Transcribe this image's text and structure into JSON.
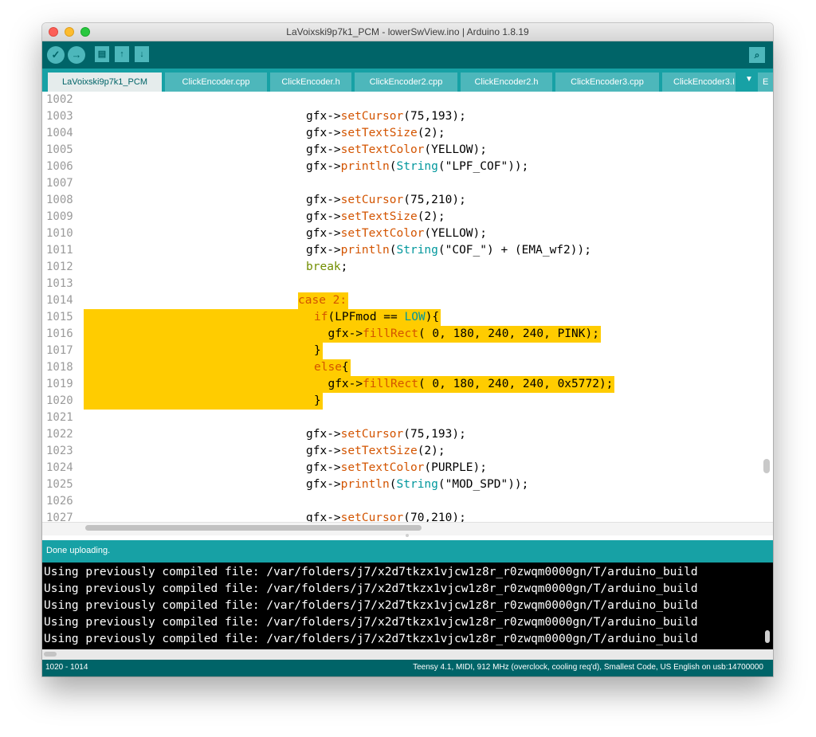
{
  "window": {
    "title": "LaVoixski9p7k1_PCM - lowerSwView.ino | Arduino 1.8.19"
  },
  "toolbar": {
    "verify_icon": "✓",
    "upload_icon": "→",
    "new_icon": "▤",
    "open_icon": "↑",
    "save_icon": "↓",
    "serial_monitor_icon": "⌕"
  },
  "tabs": [
    {
      "label": "LaVoixski9p7k1_PCM",
      "active": true
    },
    {
      "label": "ClickEncoder.cpp"
    },
    {
      "label": "ClickEncoder.h"
    },
    {
      "label": "ClickEncoder2.cpp"
    },
    {
      "label": "ClickEncoder2.h"
    },
    {
      "label": "ClickEncoder3.cpp"
    },
    {
      "label": "ClickEncoder3.I"
    },
    {
      "label": "E"
    }
  ],
  "tab_menu_icon": "▼",
  "line_numbers": [
    "1002",
    "1003",
    "1004",
    "1005",
    "1006",
    "1007",
    "1008",
    "1009",
    "1010",
    "1011",
    "1012",
    "1013",
    "1014",
    "1015",
    "1016",
    "1017",
    "1018",
    "1019",
    "1020",
    "1021",
    "1022",
    "1023",
    "1024",
    "1025",
    "1026",
    "1027"
  ],
  "code": {
    "l1003": {
      "a": "gfx->",
      "b": "setCursor",
      "c": "(75,193);"
    },
    "l1004": {
      "a": "gfx->",
      "b": "setTextSize",
      "c": "(2);"
    },
    "l1005": {
      "a": "gfx->",
      "b": "setTextColor",
      "c": "(YELLOW);"
    },
    "l1006": {
      "a": "gfx->",
      "b": "println",
      "c": "(",
      "d": "String",
      "e": "(\"LPF_COF\"));"
    },
    "l1008": {
      "a": "gfx->",
      "b": "setCursor",
      "c": "(75,210);"
    },
    "l1009": {
      "a": "gfx->",
      "b": "setTextSize",
      "c": "(2);"
    },
    "l1010": {
      "a": "gfx->",
      "b": "setTextColor",
      "c": "(YELLOW);"
    },
    "l1011": {
      "a": "gfx->",
      "b": "println",
      "c": "(",
      "d": "String",
      "e": "(\"COF_\") + (EMA_wf2));"
    },
    "l1012": {
      "a": "break",
      "b": ";"
    },
    "l1014": {
      "a": "case",
      "b": " 2:"
    },
    "l1015": {
      "a": "if",
      "b": "(LPFmod == ",
      "c": "LOW",
      "d": "){"
    },
    "l1016": {
      "a": "gfx->",
      "b": "fillRect",
      "c": "( 0, 180, 240, 240, PINK);"
    },
    "l1017": {
      "a": "}"
    },
    "l1018": {
      "a": "else",
      "b": "{"
    },
    "l1019": {
      "a": "gfx->",
      "b": "fillRect",
      "c": "( 0, 180, 240, 240, 0x5772);"
    },
    "l1020": {
      "a": "}"
    },
    "l1022": {
      "a": "gfx->",
      "b": "setCursor",
      "c": "(75,193);"
    },
    "l1023": {
      "a": "gfx->",
      "b": "setTextSize",
      "c": "(2);"
    },
    "l1024": {
      "a": "gfx->",
      "b": "setTextColor",
      "c": "(PURPLE);"
    },
    "l1025": {
      "a": "gfx->",
      "b": "println",
      "c": "(",
      "d": "String",
      "e": "(\"MOD_SPD\"));"
    },
    "l1027": {
      "a": "gfx->",
      "b": "setCursor",
      "c": "(70,210);"
    }
  },
  "status": {
    "message": "Done uploading."
  },
  "console": {
    "lines": [
      "Using previously compiled file: /var/folders/j7/x2d7tkzx1vjcw1z8r_r0zwqm0000gn/T/arduino_build",
      "Using previously compiled file: /var/folders/j7/x2d7tkzx1vjcw1z8r_r0zwqm0000gn/T/arduino_build",
      "Using previously compiled file: /var/folders/j7/x2d7tkzx1vjcw1z8r_r0zwqm0000gn/T/arduino_build",
      "Using previously compiled file: /var/folders/j7/x2d7tkzx1vjcw1z8r_r0zwqm0000gn/T/arduino_build",
      "Using previously compiled file: /var/folders/j7/x2d7tkzx1vjcw1z8r_r0zwqm0000gn/T/arduino_build"
    ]
  },
  "footer": {
    "selection": "1020 - 1014",
    "board_info": "Teensy 4.1, MIDI, 912 MHz (overclock, cooling req'd), Smallest Code, US English on usb:14700000"
  },
  "colors": {
    "toolbar": "#006468",
    "tabbar": "#17a1a5",
    "highlight": "#ffcc00",
    "keyword": "#d35400",
    "type": "#00979c",
    "constant": "#728e00"
  }
}
